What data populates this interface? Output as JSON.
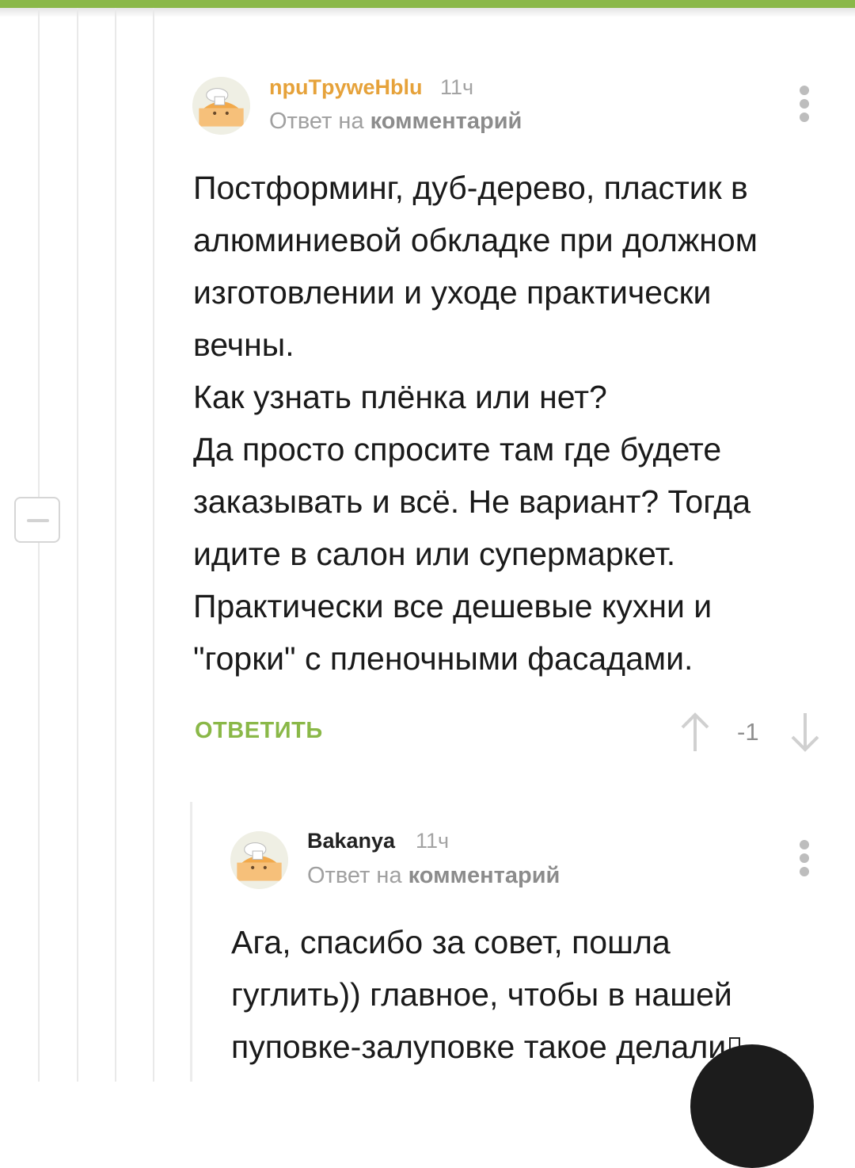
{
  "comments": [
    {
      "username": "npuTpyweHblu",
      "username_color": "#e6a23a",
      "time": "11ч",
      "reply_prefix": "Ответ на",
      "reply_target": "комментарий",
      "lines": [
        "Постформинг, дуб-дерево, пластик в",
        "алюминиевой обкладке при должном",
        "изготовлении и уходе практически",
        "вечны.",
        "Как узнать плёнка или нет?",
        "Да просто спросите там где будете",
        "заказывать и всё. Не вариант? Тогда",
        "идите в салон или супермаркет.",
        "Практически все дешевые кухни и",
        "\"горки\" с пленочными фасадами."
      ],
      "reply_label": "ОТВЕТИТЬ",
      "rating": "-1"
    },
    {
      "username": "Bakanya",
      "username_color": "#222222",
      "time": "11ч",
      "reply_prefix": "Ответ на",
      "reply_target": "комментарий",
      "lines": [
        "Ага, спасибо за совет, пошла",
        "гуглить)) главное, чтобы в нашей",
        "пуповке-залуповке такое делали"
      ]
    }
  ],
  "icons": {
    "avatar": "default-avatar-icon",
    "more": "more-vertical-icon",
    "upvote": "arrow-up-icon",
    "downvote": "arrow-down-icon",
    "collapse": "collapse-minus-icon"
  },
  "colors": {
    "accent": "#8ab848",
    "meta": "#a0a0a0"
  }
}
